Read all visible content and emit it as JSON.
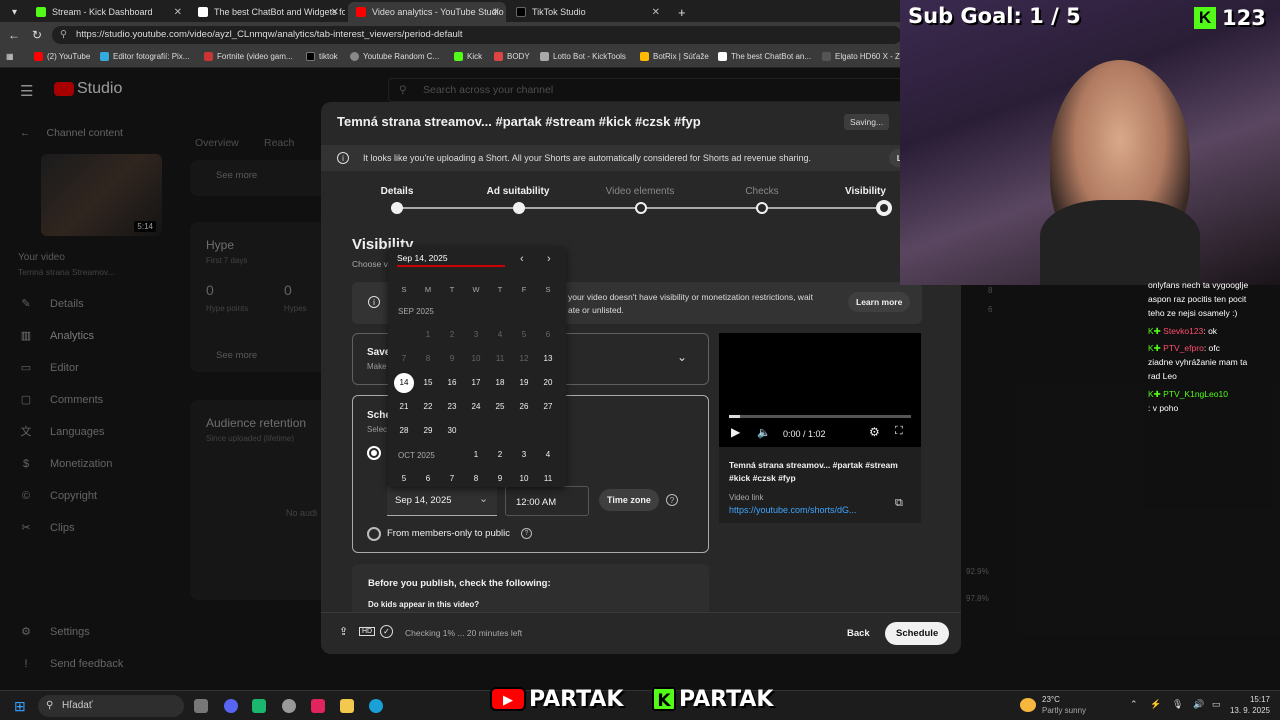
{
  "browser": {
    "tabs": [
      {
        "label": "Stream - Kick Dashboard",
        "color": "#53fc18"
      },
      {
        "label": "The best ChatBot and Widgets fo",
        "color": "#ffffff"
      },
      {
        "label": "Video analytics - YouTube Studio",
        "color": "#ff0000"
      },
      {
        "label": "TikTok Studio",
        "color": "#000000"
      }
    ],
    "url": "https://studio.youtube.com/video/ayzl_CLnmqw/analytics/tab-interest_viewers/period-default",
    "bookmarks": [
      "(2) YouTube",
      "Editor fotografií: Pix...",
      "Fortnite (video gam...",
      "tiktok",
      "Youtube Random C...",
      "Kick",
      "BODY",
      "Lotto Bot - KickTools",
      "BotRix | Súťaže",
      "The best ChatBot an...",
      "Elgato HD60 X - Z..."
    ]
  },
  "studio": {
    "logo": "Studio",
    "search_placeholder": "Search across your channel",
    "back_label": "Channel content",
    "thumb_duration": "5:14",
    "your_video": "Your video",
    "video_sub": "Temná strana Streamov...",
    "nav": [
      "Details",
      "Analytics",
      "Editor",
      "Comments",
      "Languages",
      "Monetization",
      "Copyright",
      "Clips"
    ],
    "nav_bottom": [
      "Settings",
      "Send feedback"
    ],
    "tabs": [
      "Overview",
      "Reach"
    ],
    "see_more": "See more",
    "hype_title": "Hype",
    "hype_sub": "First 7 days",
    "hype_points_value": "0",
    "hype_points_label": "Hype points",
    "hypes_value": "0",
    "hypes_label": "Hypes",
    "retention_title": "Audience retention",
    "retention_sub": "Since uploaded (lifetime)",
    "no_audience": "No audi",
    "right_values": [
      "8",
      "6",
      "92.9%",
      "97.8%"
    ]
  },
  "dialog": {
    "title": "Temná strana streamov... #partak #stream #kick #czsk #fyp",
    "saving": "Saving...",
    "banner": "It looks like you're uploading a Short. All your Shorts are automatically considered for Shorts ad revenue sharing.",
    "banner_link": "Learn more",
    "steps": [
      "Details",
      "Ad suitability",
      "Video elements",
      "Checks",
      "Visibility"
    ],
    "visibility_heading": "Visibility",
    "choose_text": "Choose v",
    "notice_text_1": "your video doesn't have visibility or monetization restrictions, wait",
    "notice_text_2": "ate or unlisted.",
    "notice_link": "Learn more",
    "save_title": "Save",
    "save_sub": "Make",
    "schedule_title": "Sche",
    "schedule_sub": "Selec",
    "date_value": "Sep 14, 2025",
    "time_value": "12:00 AM",
    "time_zone": "Time zone",
    "members_only": "From members-only to public",
    "before_publish": "Before you publish, check the following:",
    "kids_question": "Do kids appear in this video?",
    "video_time": "0:00 / 1:02",
    "video_title": "Temná strana streamov... #partak #stream #kick #czsk #fyp",
    "video_link_label": "Video link",
    "video_link": "https://youtube.com/shorts/dG...",
    "footer_status": "Checking 1% ... 20 minutes left",
    "back_button": "Back",
    "schedule_button": "Schedule"
  },
  "calendar": {
    "input": "Sep 14, 2025",
    "weekdays": [
      "S",
      "M",
      "T",
      "W",
      "T",
      "F",
      "S"
    ],
    "month1": "SEP 2025",
    "sep_disabled": [
      "1",
      "2",
      "3",
      "4",
      "5",
      "6",
      "7",
      "8",
      "9",
      "10",
      "11",
      "12"
    ],
    "sep_enabled": [
      "13",
      "14",
      "15",
      "16",
      "17",
      "18",
      "19",
      "20",
      "21",
      "22",
      "23",
      "24",
      "25",
      "26",
      "27",
      "28",
      "29",
      "30"
    ],
    "selected": "14",
    "month2": "OCT 2025",
    "oct_days": [
      "1",
      "2",
      "3",
      "4",
      "5",
      "6",
      "7",
      "8",
      "9",
      "10",
      "11"
    ]
  },
  "overlay": {
    "sub_goal": "Sub Goal: 1 / 5",
    "kick_count": "123",
    "chat": [
      {
        "user": "",
        "text": "onlyfans nech ta vygooglje",
        "color": "#ffffff"
      },
      {
        "user": "",
        "text": "aspon raz pocitis ten pocit",
        "color": "#ffffff"
      },
      {
        "user": "",
        "text": "teho ze nejsi osamely :)",
        "color": "#ffffff"
      },
      {
        "user": "Stevko123",
        "text": ": ok",
        "color": "#ff4d6d"
      },
      {
        "user": "PTV_efpro",
        "text": ": ofc",
        "color": "#ff4d6d"
      },
      {
        "user": "",
        "text": "ziadne vyhrážanie mam ta",
        "color": "#ffffff"
      },
      {
        "user": "",
        "text": "rad Leo",
        "color": "#ffffff"
      },
      {
        "user": "PTV_K1ngLeo10",
        "text": "",
        "color": "#53fc18"
      },
      {
        "user": "",
        "text": ": v poho",
        "color": "#ffffff"
      }
    ],
    "logo_youtube": "PARTAK",
    "logo_kick": "PARTAK"
  },
  "taskbar": {
    "search": "Hľadať",
    "weather_temp": "23°C",
    "weather_desc": "Partly sunny",
    "time": "15:17",
    "date": "13. 9. 2025"
  }
}
